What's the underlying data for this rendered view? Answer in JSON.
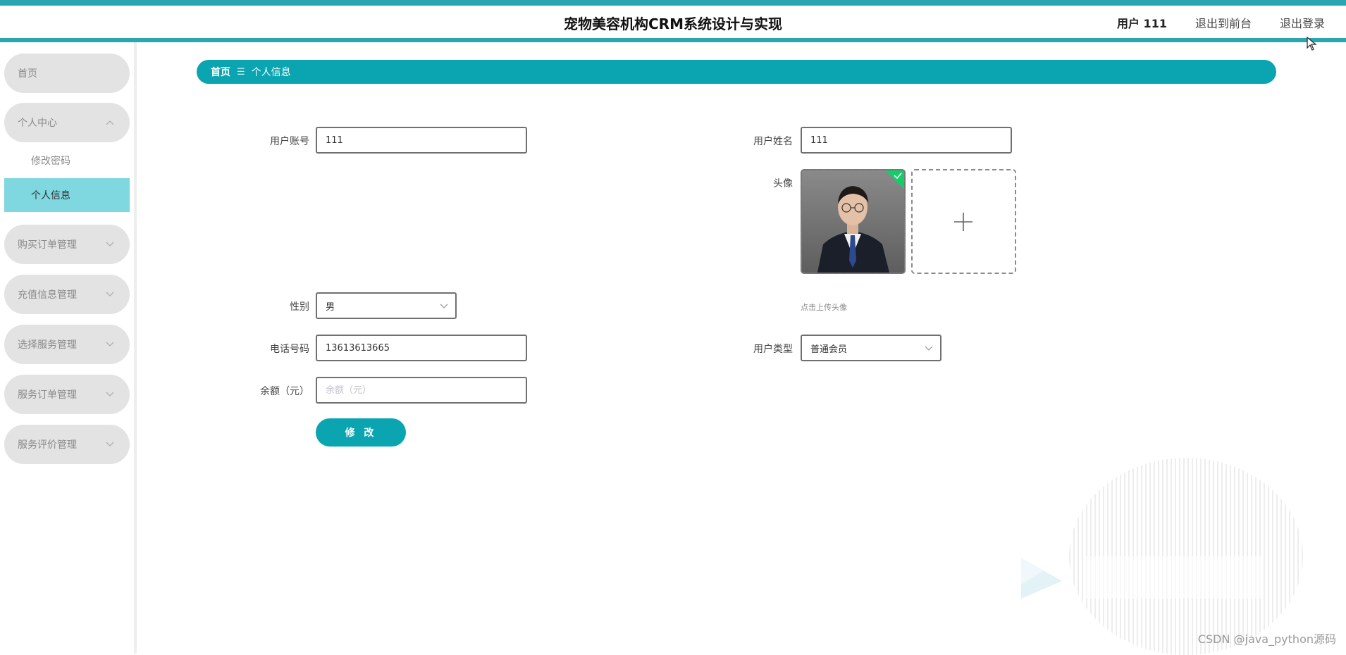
{
  "app": {
    "title": "宠物美容机构CRM系统设计与实现"
  },
  "header": {
    "user_label": "用户 111",
    "front_link": "退出到前台",
    "logout_link": "退出登录"
  },
  "sidebar": {
    "home": "首页",
    "personal_center": "个人中心",
    "personal_sub": {
      "change_password": "修改密码",
      "personal_info": "个人信息"
    },
    "items": [
      {
        "label": "购买订单管理"
      },
      {
        "label": "充值信息管理"
      },
      {
        "label": "选择服务管理"
      },
      {
        "label": "服务订单管理"
      },
      {
        "label": "服务评价管理"
      }
    ]
  },
  "breadcrumb": {
    "home": "首页",
    "separator": "☰",
    "current": "个人信息"
  },
  "form": {
    "account_label": "用户账号",
    "account_value": "111",
    "name_label": "用户姓名",
    "name_value": "111",
    "avatar_label": "头像",
    "upload_tip": "点击上传头像",
    "gender_label": "性别",
    "gender_value": "男",
    "phone_label": "电话号码",
    "phone_value": "13613613665",
    "user_type_label": "用户类型",
    "user_type_value": "普通会员",
    "balance_label": "余额（元）",
    "balance_placeholder": "余额（元）",
    "submit_label": "修 改"
  },
  "watermark": {
    "csdn": "CSDN @java_python源码"
  },
  "colors": {
    "accent": "#0aa5b0",
    "top_strip": "#2aa6b0",
    "active_menu": "#7fd7e0",
    "menu_pill": "#e3e3e3",
    "success_corner": "#13ce66"
  }
}
